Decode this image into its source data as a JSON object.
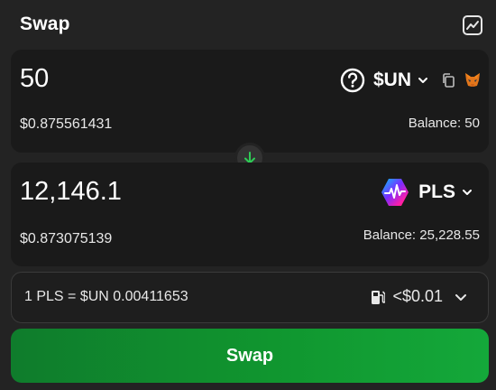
{
  "header": {
    "title": "Swap",
    "chart_icon": "chart-line-icon"
  },
  "from": {
    "amount": "50",
    "usd_value": "$0.875561431",
    "balance": "Balance: 50",
    "token": {
      "symbol": "$UN",
      "icon": "question-circle-icon"
    }
  },
  "switch": {
    "icon": "arrow-down-icon",
    "color": "#2ecc55"
  },
  "to": {
    "amount": "12,146.1",
    "usd_value": "$0.873075139",
    "balance": "Balance: 25,228.55",
    "token": {
      "symbol": "PLS",
      "icon": "pulsechain-logo-icon"
    }
  },
  "rate": {
    "text": "1 PLS = $UN 0.00411653",
    "gas": "<$0.01",
    "gas_icon": "gas-pump-icon"
  },
  "action": {
    "label": "Swap",
    "color": "#10962f"
  }
}
